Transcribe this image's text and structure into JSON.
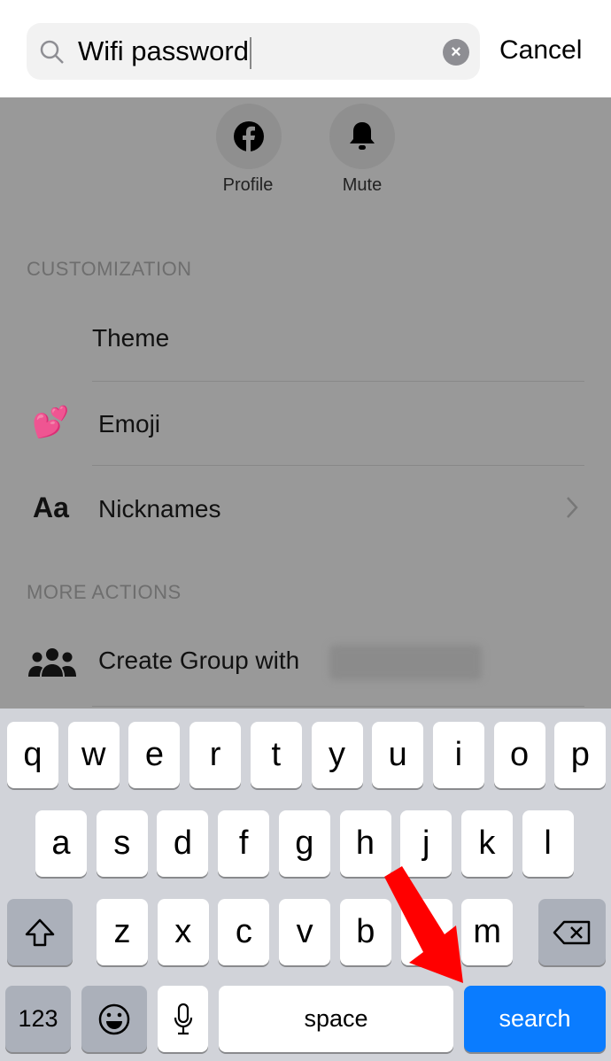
{
  "search": {
    "value": "Wifi password",
    "cancel_label": "Cancel"
  },
  "quick_actions": [
    {
      "label": "Profile",
      "icon": "facebook-icon"
    },
    {
      "label": "Mute",
      "icon": "bell-icon"
    }
  ],
  "sections": [
    {
      "header": "CUSTOMIZATION",
      "items": [
        {
          "label": "Theme"
        },
        {
          "label": "Emoji",
          "icon": "💕"
        },
        {
          "label": "Nicknames",
          "icon": "Aa"
        }
      ]
    },
    {
      "header": "MORE ACTIONS",
      "items": [
        {
          "label": "Create Group with"
        }
      ]
    }
  ],
  "keyboard": {
    "row1": [
      "q",
      "w",
      "e",
      "r",
      "t",
      "y",
      "u",
      "i",
      "o",
      "p"
    ],
    "row2": [
      "a",
      "s",
      "d",
      "f",
      "g",
      "h",
      "j",
      "k",
      "l"
    ],
    "row3": [
      "z",
      "x",
      "c",
      "v",
      "b",
      "n",
      "m"
    ],
    "numbers_label": "123",
    "space_label": "space",
    "search_label": "search",
    "accent": "#0a7cff"
  },
  "annotation": {
    "arrow_color": "#ff0000"
  }
}
